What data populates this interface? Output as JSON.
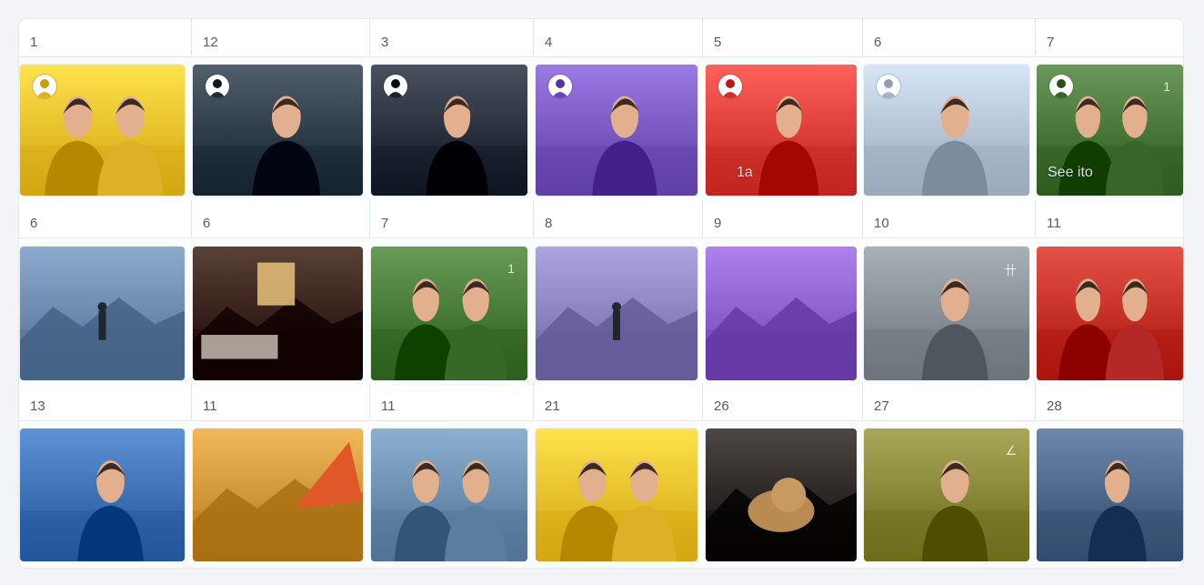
{
  "rows": [
    {
      "day_labels": [
        "1",
        "12",
        "3",
        "4",
        "5",
        "6",
        "7"
      ],
      "photos": [
        {
          "name": "couple-yellow",
          "bg": "#f2c42f",
          "avatar": true
        },
        {
          "name": "woman-forest",
          "bg": "#33414e",
          "avatar": true
        },
        {
          "name": "man-torch-smoke",
          "bg": "#2b3440",
          "avatar": true
        },
        {
          "name": "purple-silhouettes",
          "bg": "#7d5cc8",
          "avatar": true
        },
        {
          "name": "woman-red-shouting",
          "bg": "#e0433b",
          "avatar": true,
          "overlay": "1a"
        },
        {
          "name": "woman-landscape",
          "bg": "#b9c8d8",
          "avatar": true
        },
        {
          "name": "women-hug-green",
          "bg": "#4c7a3c",
          "avatar": true,
          "overlay": "See ito",
          "corner": "1"
        }
      ]
    },
    {
      "day_labels": [
        "6",
        "6",
        "7",
        "8",
        "9",
        "10",
        "11"
      ],
      "photos": [
        {
          "name": "mountain-deck",
          "bg": "#6f8db0"
        },
        {
          "name": "cabin-interior",
          "bg": "#3b2418"
        },
        {
          "name": "friends-grass",
          "bg": "#4a7d3a",
          "corner": "1"
        },
        {
          "name": "misty-forest-walker",
          "bg": "#8f86c4"
        },
        {
          "name": "purple-mountains",
          "bg": "#8f63d0"
        },
        {
          "name": "car-hand",
          "bg": "#8b9299",
          "corner": "卄"
        },
        {
          "name": "couple-red-sofa",
          "bg": "#c8332a"
        }
      ]
    },
    {
      "day_labels": [
        "13",
        "11",
        "11",
        "21",
        "26",
        "27",
        "28"
      ],
      "photos": [
        {
          "name": "man-sea-sky",
          "bg": "#3f74b8"
        },
        {
          "name": "tent-sunset-beach",
          "bg": "#d39a3c"
        },
        {
          "name": "couple-beach-kiss",
          "bg": "#6f92b2"
        },
        {
          "name": "two-men-yellow",
          "bg": "#f2c42f"
        },
        {
          "name": "dog-sofa",
          "bg": "#2f2a28"
        },
        {
          "name": "woman-camera-autumn",
          "bg": "#8a8a3a",
          "corner": "∠"
        },
        {
          "name": "man-car-laughing",
          "bg": "#4f6a8c"
        }
      ]
    }
  ]
}
